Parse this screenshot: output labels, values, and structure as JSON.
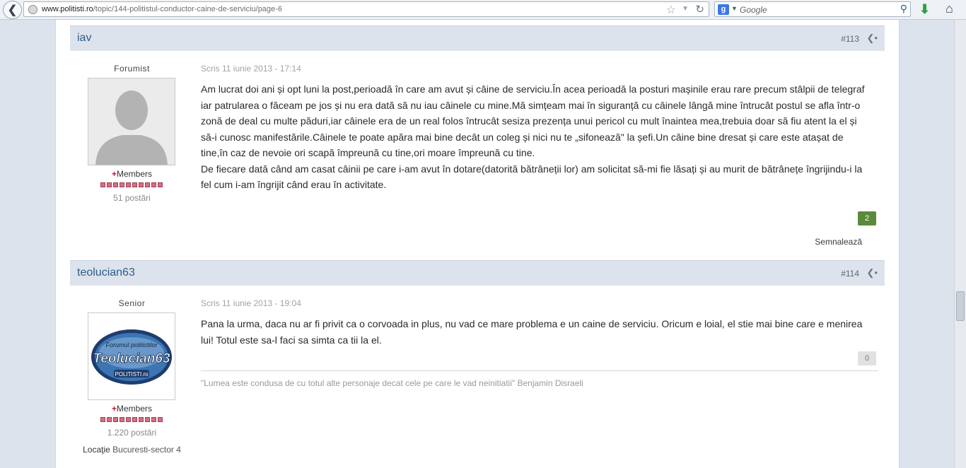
{
  "browser": {
    "back_icon": "arrow-left-icon",
    "url_domain": "www.politisti.ro",
    "url_path": "/topic/144-politistul-conductor-caine-de-serviciu/page-6",
    "search_placeholder": "Google",
    "search_engine_icon": "google-icon"
  },
  "posts": [
    {
      "author": "iav",
      "number": "#113",
      "rank_title": "Forumist",
      "group": "Members",
      "post_count": "51 postări",
      "written": "Scris 11 iunie 2013 - 17:14",
      "body_lines": [
        "Am lucrat doi ani și opt luni la post,perioadă în care am avut și câine de serviciu.În acea perioadă la posturi mașinile erau rare precum stâlpii de telegraf",
        "iar patrularea o făceam pe jos și nu era dată să nu iau câinele cu mine.Mă simțeam mai în siguranță cu câinele lângă mine întrucât postul se afla într-o",
        "zonă de deal cu multe păduri,iar câinele era de un real folos întrucât sesiza prezența unui pericol cu mult înaintea mea,trebuia doar să fiu atent la el și",
        "să-i cunosc manifestările.Câinele te poate apăra mai bine decât un coleg și nici nu te „sifonează\" la șefi.Un câine bine dresat și care este atașat de",
        "tine,în caz de nevoie ori scapă împreună cu tine,ori moare împreună cu tine.",
        "De fiecare dată când am casat câinii pe care i-am avut în dotare(datorită bătrâneții lor) am solicitat să-mi fie lăsați și au murit de bătrânețe îngrijindu-i la",
        "fel cum i-am îngrijit când erau în activitate."
      ],
      "reputation": "2",
      "report": "Semnalează"
    },
    {
      "author": "teolucian63",
      "number": "#114",
      "rank_title": "Senior",
      "group": "Members",
      "post_count": "1.220 postări",
      "location_label": "Locaţie",
      "location_value": "Bucuresti-sector 4",
      "avatar_lines": [
        "Forumul politistilor",
        "Teolucian63",
        "POLITISTI.ro"
      ],
      "written": "Scris 11 iunie 2013 - 19:04",
      "body_lines": [
        "Pana la urma, daca nu ar fi privit ca o corvoada in plus, nu vad ce mare problema e un caine de serviciu. Oricum e loial, el stie mai bine care e menirea",
        "lui! Totul este sa-l faci sa simta ca tii la el."
      ],
      "reputation": "0",
      "signature": "\"Lumea este condusa de cu totul alte personaje decat cele pe care le vad neinitiatii\" Benjamin Disraeli"
    }
  ],
  "colors": {
    "header_band": "#dde3ed",
    "author_link": "#2d5d8c",
    "reputation_positive": "#5c8a3b",
    "member_plus": "#c8102e"
  }
}
